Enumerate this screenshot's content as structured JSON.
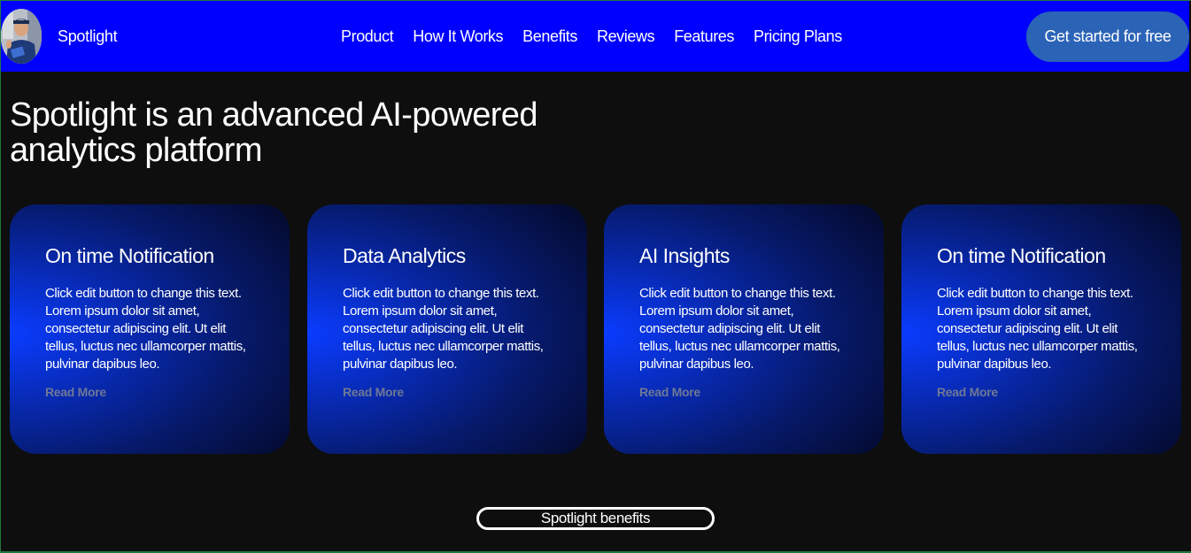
{
  "header": {
    "brand": "Spotlight",
    "nav": [
      "Product",
      "How It Works",
      "Benefits",
      "Reviews",
      "Features",
      "Pricing Plans"
    ],
    "cta": "Get started for free"
  },
  "hero": {
    "title": "Spotlight is an advanced AI-powered analytics platform"
  },
  "cards": [
    {
      "title": "On time Notification",
      "text": "Click edit button to change this text. Lorem ipsum dolor sit amet, consectetur adipiscing elit. Ut elit tellus, luctus nec ullamcorper mattis, pulvinar dapibus leo.",
      "link": "Read More"
    },
    {
      "title": "Data Analytics",
      "text": "Click edit button to change this text. Lorem ipsum dolor sit amet, consectetur adipiscing elit. Ut elit tellus, luctus nec ullamcorper mattis, pulvinar dapibus leo.",
      "link": "Read More"
    },
    {
      "title": "AI Insights",
      "text": "Click edit button to change this text. Lorem ipsum dolor sit amet, consectetur adipiscing elit. Ut elit tellus, luctus nec ullamcorper mattis, pulvinar dapibus leo.",
      "link": "Read More"
    },
    {
      "title": "On time Notification",
      "text": "Click edit button to change this text. Lorem ipsum dolor sit amet, consectetur adipiscing elit. Ut elit tellus, luctus nec ullamcorper mattis, pulvinar dapibus leo.",
      "link": "Read More"
    }
  ],
  "benefits_button": "Spotlight benefits",
  "colors": {
    "nav_bg": "#0000ff",
    "page_bg": "#0e0e0e",
    "cta_bg": "#2b63b7",
    "card_glow": "#0a3cff",
    "read_more": "#6f7896"
  }
}
